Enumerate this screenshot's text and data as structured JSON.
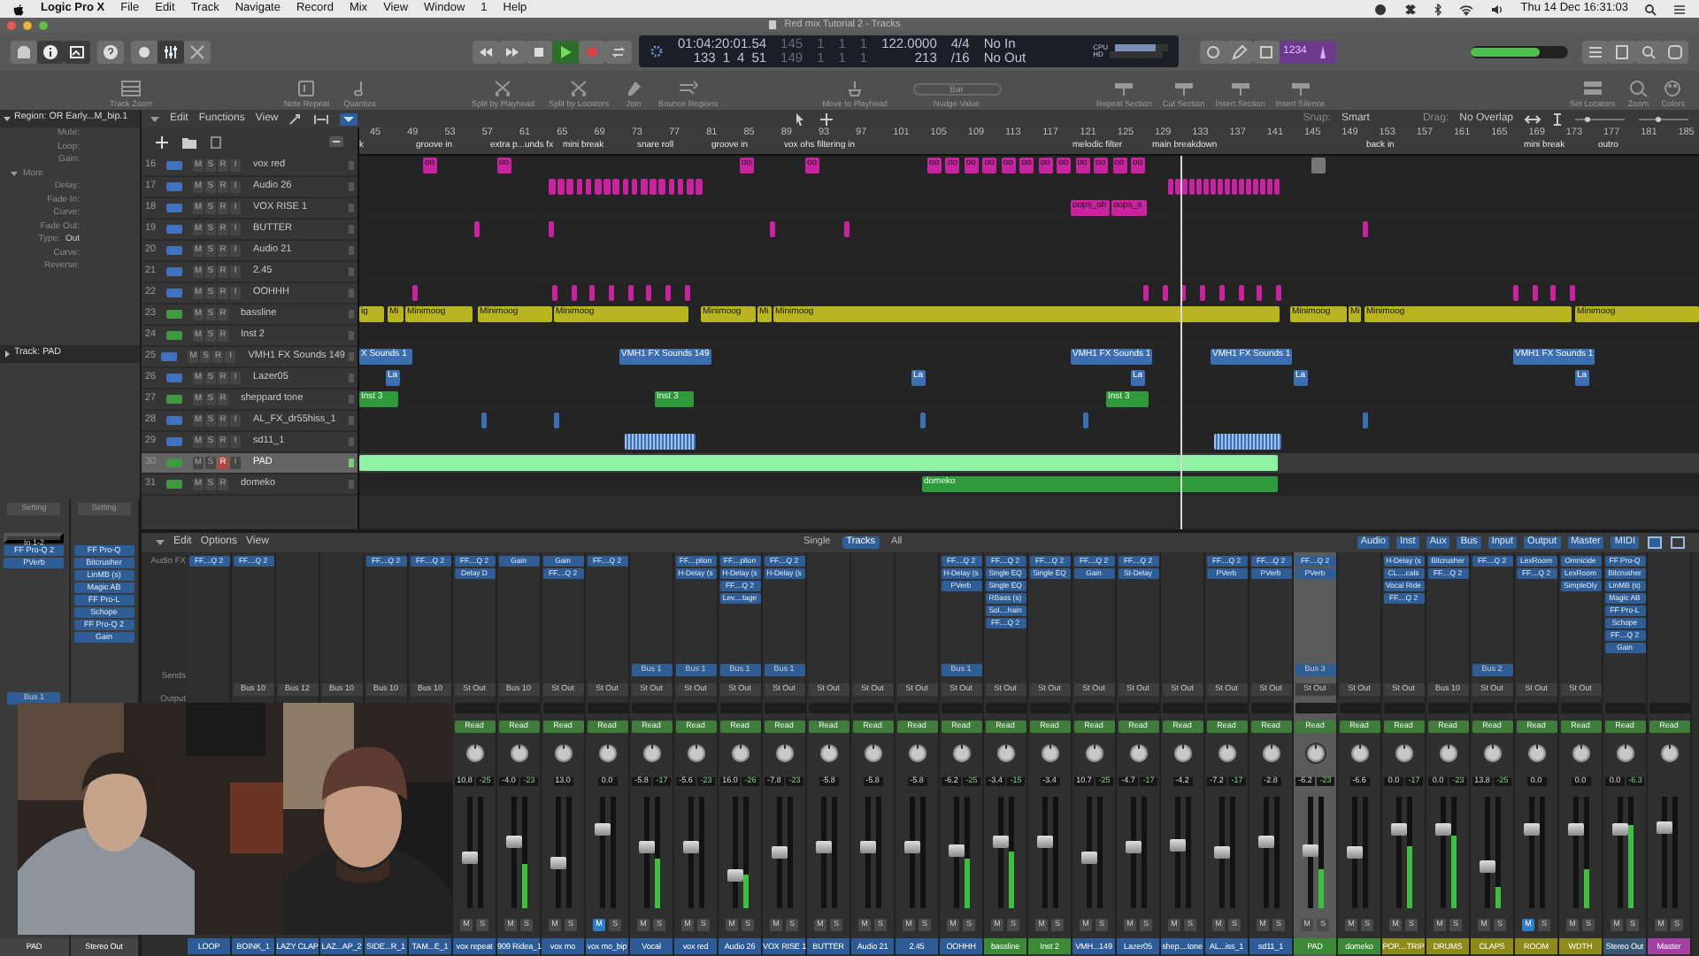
{
  "menubar": {
    "app": "Logic Pro X",
    "menus": [
      "File",
      "Edit",
      "Track",
      "Navigate",
      "Record",
      "Mix",
      "View",
      "Window",
      "1",
      "Help"
    ],
    "clock": "Thu 14 Dec  16:31:03"
  },
  "window": {
    "title": "Red mix Tutorial 2 - Tracks"
  },
  "lcd": {
    "time": "01:04:20:01.54",
    "bars": [
      "133",
      "1",
      "4",
      "51"
    ],
    "left_locator": [
      "145",
      "1",
      "1",
      "1"
    ],
    "right_locator": [
      "149",
      "1",
      "1",
      "1"
    ],
    "tempo": "122.0000",
    "tempo_sub": "213",
    "signature": "4/4",
    "division": "/16",
    "input": "No In",
    "output": "No Out",
    "cpu": "CPU",
    "cpu_meter": {
      "level": 0.75
    },
    "hd": "HD"
  },
  "transport": {
    "playing": true
  },
  "count_in": {
    "label": "1234",
    "on": true
  },
  "master_volume": {
    "level": 0.7
  },
  "toolbar": [
    {
      "label": "Track Zoom",
      "kind": "zoom"
    },
    {
      "label": "Note Repeat",
      "kind": "repeat"
    },
    {
      "label": "Quantize",
      "kind": "note"
    },
    {
      "label": "Split by Playhead",
      "kind": "split"
    },
    {
      "label": "Split by Locators",
      "kind": "split"
    },
    {
      "label": "Join",
      "kind": "join"
    },
    {
      "label": "Bounce Regions",
      "kind": "bounce"
    },
    {
      "label": "Move to Playhead",
      "kind": "move"
    },
    {
      "label": "Nudge Value",
      "kind": "nudge",
      "value": "Bar"
    },
    {
      "label": "Repeat Section",
      "kind": "section"
    },
    {
      "label": "Cut Section",
      "kind": "section"
    },
    {
      "label": "Insert Section",
      "kind": "section"
    },
    {
      "label": "Insert Silence",
      "kind": "section"
    },
    {
      "label": "Set Locators",
      "kind": "locators"
    },
    {
      "label": "Zoom",
      "kind": "magnify"
    },
    {
      "label": "Colors",
      "kind": "palette"
    }
  ],
  "inspector": {
    "region_title": "Region: OR Early...M_bip.1",
    "params": [
      {
        "label": "Mute:"
      },
      {
        "label": "Loop:"
      },
      {
        "label": "Gain:"
      },
      {
        "label": "More",
        "kind": "group"
      },
      {
        "label": "Delay:"
      },
      {
        "label": "Fade In:"
      },
      {
        "label": "Curve:"
      },
      {
        "label": "Fade Out:"
      },
      {
        "label": "Type:",
        "value": "Out"
      },
      {
        "label": "Curve:"
      },
      {
        "label": "Reverse:"
      }
    ],
    "track_title": "Track: PAD",
    "strips": [
      {
        "setting": "Setting",
        "input": "In 1-2",
        "fx": [
          "FF Pro-Q 2",
          "PVerb"
        ],
        "send": "Bus 1",
        "name": "PAD"
      },
      {
        "setting": "Setting",
        "fx": [
          "FF Pro-Q",
          "Bitcrusher",
          "LinMB (s)",
          "Magic AB",
          "FF Pro-L",
          "Schope",
          "FF Pro-Q 2",
          "Gain"
        ],
        "name": "Stereo Out"
      }
    ]
  },
  "arrange": {
    "menus": [
      "Edit",
      "Functions",
      "View"
    ],
    "snap_label": "Snap:",
    "snap": "Smart",
    "drag_label": "Drag:",
    "drag": "No Overlap",
    "ruler": [
      "45",
      "49",
      "53",
      "57",
      "61",
      "65",
      "69",
      "73",
      "77",
      "81",
      "85",
      "89",
      "93",
      "97",
      "101",
      "105",
      "109",
      "113",
      "117",
      "121",
      "125",
      "129",
      "133",
      "137",
      "141",
      "145",
      "149",
      "153",
      "157",
      "161",
      "165",
      "169",
      "173",
      "177",
      "181",
      "185"
    ],
    "markers": [
      {
        "label": "k"
      },
      {
        "label": "groove in"
      },
      {
        "label": "extra p...unds fx"
      },
      {
        "label": "mini break"
      },
      {
        "label": "snare roll"
      },
      {
        "label": "groove in"
      },
      {
        "label": "vox ohs filtering in"
      },
      {
        "label": "melodic filter"
      },
      {
        "label": "main breakdown"
      },
      {
        "label": "back in"
      },
      {
        "label": "mini break"
      },
      {
        "label": "outro"
      }
    ]
  },
  "tracks": [
    {
      "number": "16",
      "name": "vox red",
      "kind": "audio",
      "color": "#c8249f",
      "selected": false,
      "armed": false,
      "buttons": [
        "M",
        "S",
        "R",
        "I"
      ],
      "regions": [
        {
          "label": "oo"
        },
        {
          "label": "oo"
        },
        {
          "label": "oo"
        },
        {
          "label": "oo"
        },
        {
          "label": "oo"
        },
        {
          "label": "oo"
        },
        {
          "label": "oo"
        },
        {
          "label": "oo"
        },
        {
          "label": "oo"
        },
        {
          "label": "oo"
        },
        {
          "label": "oo"
        },
        {
          "label": "oo"
        },
        {
          "label": "oo"
        },
        {
          "label": "oo"
        },
        {
          "label": "oo"
        },
        {
          "label": "oo"
        }
      ]
    },
    {
      "number": "17",
      "name": "Audio 26",
      "kind": "audio",
      "color": "#c8249f",
      "selected": false,
      "armed": false,
      "buttons": [
        "M",
        "S",
        "R",
        "I"
      ]
    },
    {
      "number": "18",
      "name": "VOX RISE 1",
      "kind": "audio",
      "color": "#c8249f",
      "selected": false,
      "armed": false,
      "buttons": [
        "M",
        "S",
        "R",
        "I"
      ],
      "regions": [
        {
          "label": "oops_oh"
        },
        {
          "label": "oops_s"
        }
      ]
    },
    {
      "number": "19",
      "name": "BUTTER",
      "kind": "audio",
      "color": "#c8249f",
      "selected": false,
      "armed": false,
      "buttons": [
        "M",
        "S",
        "R",
        "I"
      ]
    },
    {
      "number": "20",
      "name": "Audio 21",
      "kind": "audio",
      "selected": false,
      "armed": false,
      "buttons": [
        "M",
        "S",
        "R",
        "I"
      ]
    },
    {
      "number": "21",
      "name": "2.45",
      "kind": "audio",
      "selected": false,
      "armed": false,
      "buttons": [
        "M",
        "S",
        "R",
        "I"
      ]
    },
    {
      "number": "22",
      "name": "OOHHH",
      "kind": "audio",
      "color": "#c8249f",
      "selected": false,
      "armed": false,
      "buttons": [
        "M",
        "S",
        "R",
        "I"
      ]
    },
    {
      "number": "23",
      "name": "bassline",
      "kind": "instrument",
      "color": "#b9b51e",
      "selected": false,
      "armed": false,
      "buttons": [
        "M",
        "S",
        "R"
      ],
      "regions": [
        {
          "label": "ig"
        },
        {
          "label": "Mi"
        },
        {
          "label": "Minimoog"
        },
        {
          "label": "Minimoog"
        },
        {
          "label": "Minimoog"
        },
        {
          "label": "Minimoog"
        },
        {
          "label": "Mi"
        },
        {
          "label": "Minimoog"
        },
        {
          "label": "Minimoog"
        },
        {
          "label": "Mi"
        },
        {
          "label": "Minimoog"
        },
        {
          "label": "Minimoog"
        }
      ]
    },
    {
      "number": "24",
      "name": "Inst 2",
      "kind": "instrument",
      "selected": false,
      "armed": false,
      "buttons": [
        "M",
        "S",
        "R"
      ]
    },
    {
      "number": "25",
      "name": "VMH1 FX Sounds 149",
      "kind": "audio",
      "color": "#3c6fb2",
      "selected": false,
      "armed": false,
      "buttons": [
        "M",
        "S",
        "R",
        "I"
      ],
      "regions": [
        {
          "label": "X Sounds 1"
        },
        {
          "label": "VMH1 FX Sounds 149"
        },
        {
          "label": "VMH1 FX Sounds 1"
        },
        {
          "label": "VMH1 FX Sounds 1"
        },
        {
          "label": "VMH1 FX Sounds 1"
        }
      ]
    },
    {
      "number": "26",
      "name": "Lazer05",
      "kind": "audio",
      "color": "#3c6fb2",
      "selected": false,
      "armed": false,
      "buttons": [
        "M",
        "S",
        "R",
        "I"
      ],
      "regions": [
        {
          "label": "La"
        },
        {
          "label": "La"
        },
        {
          "label": "La"
        },
        {
          "label": "La"
        },
        {
          "label": "La"
        }
      ]
    },
    {
      "number": "27",
      "name": "sheppard tone",
      "kind": "instrument",
      "color": "#2f9a3c",
      "selected": false,
      "armed": false,
      "buttons": [
        "M",
        "S",
        "R"
      ],
      "regions": [
        {
          "label": "Inst 3"
        },
        {
          "label": "Inst 3"
        },
        {
          "label": "Inst 3"
        }
      ]
    },
    {
      "number": "28",
      "name": "AL_FX_dr55hiss_1",
      "kind": "audio",
      "color": "#3c6fb2",
      "selected": false,
      "armed": false,
      "buttons": [
        "M",
        "S",
        "R",
        "I"
      ]
    },
    {
      "number": "29",
      "name": "sd11_1",
      "kind": "audio",
      "color": "#3c6fb2",
      "selected": false,
      "armed": false,
      "buttons": [
        "M",
        "S",
        "R",
        "I"
      ]
    },
    {
      "number": "30",
      "name": "PAD",
      "kind": "instrument",
      "color": "#8ef0a2",
      "selected": true,
      "armed": true,
      "buttons": [
        "M",
        "S",
        "R",
        "I"
      ]
    },
    {
      "number": "31",
      "name": "domeko",
      "kind": "instrument",
      "color": "#2f9a3c",
      "selected": false,
      "armed": false,
      "buttons": [
        "M",
        "S",
        "R"
      ],
      "regions": [
        {
          "label": "domeko"
        }
      ]
    }
  ],
  "mixer": {
    "menus": [
      "Edit",
      "Options",
      "View"
    ],
    "views": [
      {
        "label": "Single",
        "selected": false
      },
      {
        "label": "Tracks",
        "selected": true
      },
      {
        "label": "All",
        "selected": false
      }
    ],
    "filters": [
      "Audio",
      "Inst",
      "Aux",
      "Bus",
      "Input",
      "Output",
      "Master",
      "MIDI"
    ],
    "row_labels": {
      "fx": "Audio FX",
      "sends": "Sends",
      "output": "Output"
    }
  },
  "strips": [
    {
      "name": "LOOP",
      "kind": "audio",
      "fx": [
        "FF....Q 2"
      ]
    },
    {
      "name": "BOINK_1",
      "kind": "audio",
      "fx": [
        "FF....Q 2"
      ],
      "output": "Bus 10"
    },
    {
      "name": "LAZY CLAP",
      "kind": "audio",
      "output": "Bus 12"
    },
    {
      "name": "LAZ...AP_2",
      "kind": "audio",
      "output": "Bus 10"
    },
    {
      "name": "SIDE...R_1",
      "kind": "audio",
      "fx": [
        "FF....Q 2"
      ],
      "output": "Bus 10"
    },
    {
      "name": "TAM...E_1",
      "kind": "audio",
      "fx": [
        "FF....Q 2"
      ],
      "output": "Bus 10"
    },
    {
      "name": "vox repeat",
      "kind": "audio",
      "selected": false,
      "fx": [
        "FF....Q 2",
        "Delay D"
      ],
      "output": "St Out",
      "automation": "Read",
      "value": "10.8",
      "peak": "-25",
      "muted": false,
      "buttons": [
        "M",
        "S"
      ],
      "fader": {
        "level": 0.45
      }
    },
    {
      "name": "909 Ridea_1",
      "kind": "audio",
      "selected": false,
      "fx": [
        "Gain"
      ],
      "output": "Bus 10",
      "automation": "Read",
      "value": "-4.0",
      "peak": "-23",
      "muted": false,
      "buttons": [
        "M",
        "S"
      ],
      "fader": {
        "level": 0.6
      },
      "meter": {
        "level": 0.4
      }
    },
    {
      "name": "vox mo",
      "kind": "audio",
      "selected": false,
      "fx": [
        "Gain",
        "FF....Q 2"
      ],
      "output": "St Out",
      "automation": "Read",
      "value": "13.0",
      "muted": false,
      "buttons": [
        "M",
        "S"
      ],
      "fader": {
        "level": 0.4
      }
    },
    {
      "name": "vox mo_bip",
      "kind": "audio",
      "selected": false,
      "fx": [
        "FF....Q 2"
      ],
      "output": "St Out",
      "automation": "Read",
      "value": "0.0",
      "muted": true,
      "buttons": [
        "M",
        "S"
      ],
      "fader": {
        "level": 0.7
      }
    },
    {
      "name": "Vocal",
      "kind": "audio",
      "selected": false,
      "send": "Bus 1",
      "output": "St Out",
      "automation": "Read",
      "value": "-5.8",
      "peak": "-17",
      "muted": false,
      "buttons": [
        "M",
        "S"
      ],
      "fader": {
        "level": 0.55
      },
      "meter": {
        "level": 0.45
      }
    },
    {
      "name": "vox red",
      "kind": "audio",
      "selected": false,
      "fx": [
        "FF....plion",
        "H-Delay (s"
      ],
      "send": "Bus 1",
      "output": "St Out",
      "automation": "Read",
      "value": "-5.6",
      "peak": "-23",
      "muted": false,
      "buttons": [
        "M",
        "S"
      ],
      "fader": {
        "level": 0.55
      }
    },
    {
      "name": "Audio 26",
      "kind": "audio",
      "selected": false,
      "fx": [
        "FF....plion",
        "H-Delay (s",
        "FF....Q 2",
        "Lev....tage"
      ],
      "send": "Bus 1",
      "output": "St Out",
      "automation": "Read",
      "value": "16.0",
      "peak": "-26",
      "muted": false,
      "buttons": [
        "M",
        "S"
      ],
      "fader": {
        "level": 0.3
      },
      "meter": {
        "level": 0.3
      }
    },
    {
      "name": "VOX RISE 1",
      "kind": "audio",
      "selected": false,
      "fx": [
        "FF....Q 2",
        "H-Delay (s"
      ],
      "send": "Bus 1",
      "output": "St Out",
      "automation": "Read",
      "value": "-7.8",
      "peak": "-23",
      "muted": false,
      "buttons": [
        "M",
        "S"
      ],
      "fader": {
        "level": 0.5
      }
    },
    {
      "name": "BUTTER",
      "kind": "audio",
      "selected": false,
      "output": "St Out",
      "automation": "Read",
      "value": "-5.8",
      "muted": false,
      "buttons": [
        "M",
        "S"
      ],
      "fader": {
        "level": 0.55
      }
    },
    {
      "name": "Audio 21",
      "kind": "audio",
      "selected": false,
      "output": "St Out",
      "automation": "Read",
      "value": "-5.8",
      "muted": false,
      "buttons": [
        "M",
        "S"
      ],
      "fader": {
        "level": 0.55
      }
    },
    {
      "name": "2.45",
      "kind": "audio",
      "selected": false,
      "output": "St Out",
      "automation": "Read",
      "value": "-5.8",
      "muted": false,
      "buttons": [
        "M",
        "S"
      ],
      "fader": {
        "level": 0.55
      }
    },
    {
      "name": "OOHHH",
      "kind": "audio",
      "selected": false,
      "fx": [
        "FF....Q 2",
        "H-Delay (s",
        "PVerb"
      ],
      "send": "Bus 1",
      "output": "St Out",
      "automation": "Read",
      "value": "-6.2",
      "peak": "-25",
      "muted": false,
      "buttons": [
        "M",
        "S"
      ],
      "fader": {
        "level": 0.52
      },
      "meter": {
        "level": 0.45
      }
    },
    {
      "name": "bassline",
      "kind": "inst",
      "selected": false,
      "fx": [
        "FF....Q 2",
        "Single EQ",
        "Single EQ",
        "RBass (s)",
        "Sol....hain",
        "FF....Q 2"
      ],
      "output": "St Out",
      "automation": "Read",
      "value": "-3.4",
      "peak": "-15",
      "muted": false,
      "buttons": [
        "M",
        "S"
      ],
      "fader": {
        "level": 0.6
      },
      "meter": {
        "level": 0.5
      }
    },
    {
      "name": "Inst 2",
      "kind": "inst",
      "selected": false,
      "fx": [
        "FF....Q 2",
        "Single EQ"
      ],
      "output": "St Out",
      "automation": "Read",
      "value": "-3.4",
      "muted": false,
      "buttons": [
        "M",
        "S"
      ],
      "fader": {
        "level": 0.6
      }
    },
    {
      "name": "VMH...149",
      "kind": "audio",
      "selected": false,
      "fx": [
        "FF....Q 2",
        "Gain"
      ],
      "output": "St Out",
      "automation": "Read",
      "value": "10.7",
      "peak": "-25",
      "muted": false,
      "buttons": [
        "M",
        "S"
      ],
      "fader": {
        "level": 0.45
      }
    },
    {
      "name": "Lazer05",
      "kind": "audio",
      "selected": false,
      "fx": [
        "FF....Q 2",
        "St-Delay"
      ],
      "output": "St Out",
      "automation": "Read",
      "value": "-4.7",
      "peak": "-17",
      "muted": false,
      "buttons": [
        "M",
        "S"
      ],
      "fader": {
        "level": 0.55
      }
    },
    {
      "name": "shep....tone",
      "kind": "audio",
      "selected": false,
      "output": "St Out",
      "automation": "Read",
      "value": "-4.2",
      "muted": false,
      "buttons": [
        "M",
        "S"
      ],
      "fader": {
        "level": 0.56
      }
    },
    {
      "name": "AL...iss_1",
      "kind": "audio",
      "selected": false,
      "fx": [
        "FF....Q 2",
        "PVerb"
      ],
      "output": "St Out",
      "automation": "Read",
      "value": "-7.2",
      "peak": "-17",
      "muted": false,
      "buttons": [
        "M",
        "S"
      ],
      "fader": {
        "level": 0.5
      }
    },
    {
      "name": "sd11_1",
      "kind": "audio",
      "selected": false,
      "fx": [
        "FF....Q 2",
        "PVerb"
      ],
      "output": "St Out",
      "automation": "Read",
      "value": "-2.8",
      "muted": false,
      "buttons": [
        "M",
        "S"
      ],
      "fader": {
        "level": 0.6
      }
    },
    {
      "name": "PAD",
      "kind": "inst",
      "selected": true,
      "fx": [
        "FF....Q 2",
        "PVerb"
      ],
      "send": "Bus 3",
      "output": "St Out",
      "automation": "Read",
      "value": "-6.2",
      "peak": "-23",
      "muted": false,
      "buttons": [
        "M",
        "S"
      ],
      "fader": {
        "level": 0.52
      },
      "meter": {
        "level": 0.35
      }
    },
    {
      "name": "domeko",
      "kind": "inst",
      "selected": false,
      "output": "St Out",
      "automation": "Read",
      "value": "-6.6",
      "muted": false,
      "buttons": [
        "M",
        "S"
      ],
      "fader": {
        "level": 0.5
      }
    },
    {
      "name": "POP....TRIP",
      "kind": "aux",
      "selected": false,
      "fx": [
        "H-Delay (s",
        "CL....cals",
        "Vocal Ride",
        "FF....Q 2"
      ],
      "output": "St Out",
      "automation": "Read",
      "value": "0.0",
      "peak": "-17",
      "muted": false,
      "buttons": [
        "M",
        "S"
      ],
      "fader": {
        "level": 0.7
      },
      "meter": {
        "level": 0.55
      }
    },
    {
      "name": "DRUMS",
      "kind": "aux",
      "selected": false,
      "fx": [
        "Bitcrusher",
        "FF....Q 2"
      ],
      "output": "Bus 10",
      "automation": "Read",
      "value": "0.0",
      "peak": "-23",
      "muted": false,
      "buttons": [
        "M",
        "S"
      ],
      "fader": {
        "level": 0.7
      },
      "meter": {
        "level": 0.65
      }
    },
    {
      "name": "CLAPS",
      "kind": "aux",
      "selected": false,
      "fx": [
        "FF....Q 2"
      ],
      "send": "Bus 2",
      "output": "St Out",
      "automation": "Read",
      "value": "13.8",
      "peak": "-25",
      "muted": false,
      "buttons": [
        "M",
        "S"
      ],
      "fader": {
        "level": 0.38
      },
      "meter": {
        "level": 0.2
      }
    },
    {
      "name": "ROOM",
      "kind": "aux",
      "selected": false,
      "fx": [
        "LexRoom",
        "FF....Q 2"
      ],
      "output": "St Out",
      "automation": "Read",
      "value": "0.0",
      "muted": true,
      "buttons": [
        "M",
        "S"
      ],
      "fader": {
        "level": 0.7
      }
    },
    {
      "name": "WDTH",
      "kind": "aux",
      "selected": false,
      "fx": [
        "Omnicide",
        "LexRoom",
        "SimpleDly"
      ],
      "output": "St Out",
      "automation": "Read",
      "value": "0.0",
      "muted": false,
      "buttons": [
        "M",
        "S"
      ],
      "fader": {
        "level": 0.7
      },
      "meter": {
        "level": 0.35
      }
    },
    {
      "name": "Stereo Out",
      "kind": "output",
      "selected": false,
      "fx": [
        "FF Pro-Q",
        "Bitcrusher",
        "LinMB (s)",
        "Magic AB",
        "FF Pro-L",
        "Schope",
        "FF....Q 2",
        "Gain"
      ],
      "automation": "Read",
      "value": "0.0",
      "peak": "-6.3",
      "muted": false,
      "buttons": [
        "M",
        "S"
      ],
      "fader": {
        "level": 0.7
      },
      "meter": {
        "level": 0.75
      }
    },
    {
      "name": "Master",
      "kind": "master",
      "selected": false,
      "automation": "Read",
      "muted": false,
      "buttons": [
        "M",
        "S"
      ],
      "fader": {
        "level": 0.72
      }
    }
  ]
}
